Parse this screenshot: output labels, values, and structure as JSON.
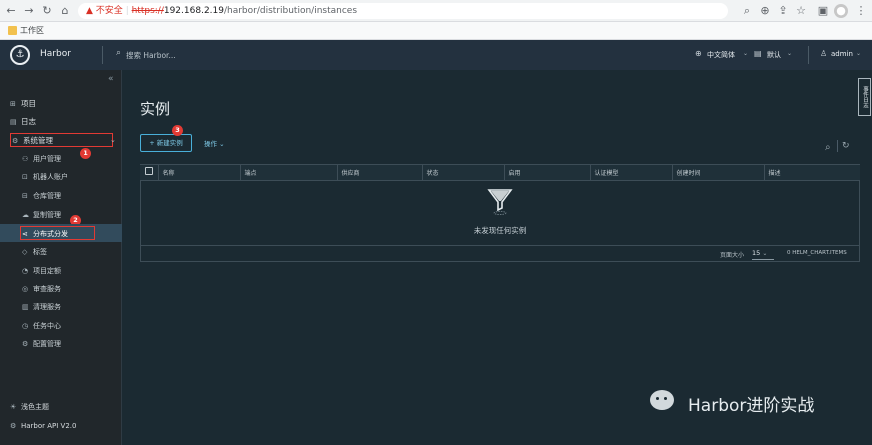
{
  "browser": {
    "security_warning": "不安全",
    "url_protocol": "https://",
    "url_host": "192.168.2.19",
    "url_path": "/harbor/distribution/instances",
    "bookmark": "工作区"
  },
  "header": {
    "app_name": "Harbor",
    "search_placeholder": "搜索 Harbor...",
    "language": "中文简体",
    "theme": "默认",
    "user": "admin"
  },
  "sidebar": {
    "items": [
      {
        "label": "项目",
        "icon": "project-icon"
      },
      {
        "label": "日志",
        "icon": "log-icon"
      },
      {
        "label": "系统管理",
        "icon": "admin-icon"
      }
    ],
    "sub_items": [
      {
        "label": "用户管理",
        "icon": "users-icon"
      },
      {
        "label": "机器人账户",
        "icon": "robot-icon"
      },
      {
        "label": "仓库管理",
        "icon": "registry-icon"
      },
      {
        "label": "复制管理",
        "icon": "replication-icon"
      },
      {
        "label": "分布式分发",
        "icon": "share-icon"
      },
      {
        "label": "标签",
        "icon": "tag-icon"
      },
      {
        "label": "项目定额",
        "icon": "quota-icon"
      },
      {
        "label": "审查服务",
        "icon": "scanner-icon"
      },
      {
        "label": "清理服务",
        "icon": "trash-icon"
      },
      {
        "label": "任务中心",
        "icon": "tasks-icon"
      },
      {
        "label": "配置管理",
        "icon": "settings-icon"
      }
    ],
    "theme_toggle": "浅色主题",
    "api": "Harbor API V2.0",
    "badges": [
      "1",
      "2"
    ]
  },
  "main": {
    "title": "实例",
    "new_button": "+ 新建实例",
    "actions": "操作",
    "badge": "3",
    "columns": [
      "名称",
      "端点",
      "供应商",
      "状态",
      "启用",
      "认证模型",
      "创建时间",
      "描述"
    ],
    "empty_text": "未发现任何实例",
    "page_size_label": "页面大小",
    "page_size": "15",
    "items_count": "0 HELM_CHART.ITEMS",
    "side_tab": "事件日志"
  },
  "watermark": {
    "text": "Harbor进阶实战"
  },
  "colors": {
    "accent": "#49afd9",
    "badge": "#e23a34",
    "highlight_border": "#e23a34"
  }
}
